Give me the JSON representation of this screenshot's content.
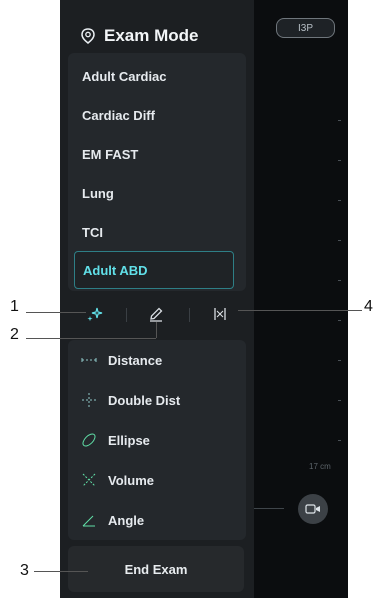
{
  "header": {
    "title": "Exam Mode"
  },
  "presets": [
    {
      "label": "Adult Cardiac",
      "active": false
    },
    {
      "label": "Cardiac Diff",
      "active": false
    },
    {
      "label": "EM FAST",
      "active": false
    },
    {
      "label": "Lung",
      "active": false
    },
    {
      "label": "TCI",
      "active": false
    },
    {
      "label": "Adult ABD",
      "active": true
    }
  ],
  "toolbar": {
    "items": [
      {
        "icon": "sparkle-icon"
      },
      {
        "icon": "pencil-icon"
      },
      {
        "icon": "caliper-icon"
      }
    ]
  },
  "measure_tools": [
    {
      "label": "Distance",
      "icon": "distance-icon"
    },
    {
      "label": "Double Dist",
      "icon": "double-distance-icon"
    },
    {
      "label": "Ellipse",
      "icon": "ellipse-icon"
    },
    {
      "label": "Volume",
      "icon": "volume-icon"
    },
    {
      "label": "Angle",
      "icon": "angle-icon"
    }
  ],
  "end_exam": {
    "label": "End Exam"
  },
  "probe": {
    "label": "I3P"
  },
  "depth": {
    "label": "17 cm"
  },
  "callouts": [
    "1",
    "2",
    "3",
    "4"
  ],
  "colors": {
    "accent": "#61e0e8",
    "panel": "#1c1f22",
    "text": "#e6eaee"
  }
}
